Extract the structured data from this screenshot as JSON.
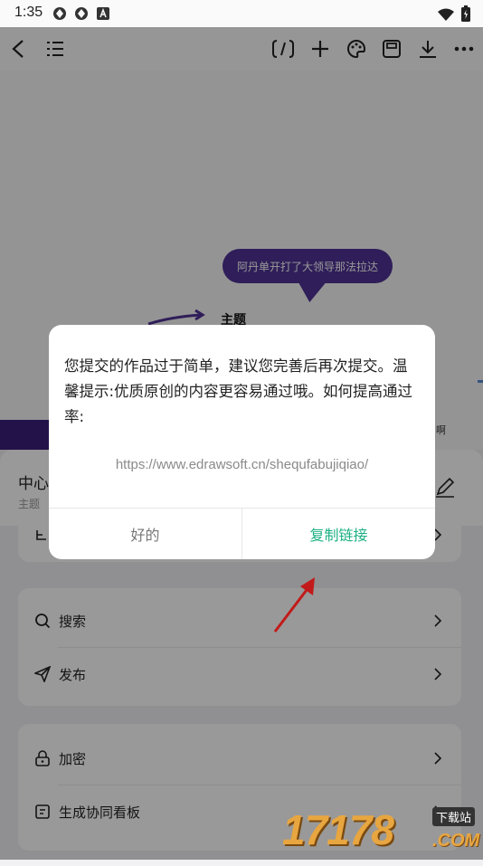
{
  "status_bar": {
    "time": "1:35"
  },
  "toolbar": {
    "back_icon": "back-arrow-icon",
    "outline_icon": "outline-list-icon",
    "format_icon": "format-bracket-icon",
    "add_icon": "plus-icon",
    "theme_icon": "palette-icon",
    "save_icon": "save-icon",
    "download_icon": "download-icon",
    "more_icon": "more-dots-icon"
  },
  "canvas": {
    "bubble_text": "阿丹单开打了大领导那法拉达",
    "topic_text": "主题",
    "edge_text": "啊"
  },
  "sheet": {
    "title": "中心",
    "subtitle": "主题",
    "items": [
      {
        "label": "搜索",
        "icon": "search-icon"
      },
      {
        "label": "发布",
        "icon": "send-icon"
      },
      {
        "label": "加密",
        "icon": "lock-icon"
      },
      {
        "label": "生成协同看板",
        "icon": "board-icon"
      }
    ]
  },
  "dialog": {
    "message": "您提交的作品过于简单，建议您完善后再次提交。温馨提示:优质原创的内容更容易通过哦。如何提高通过率:",
    "url": "https://www.edrawsoft.cn/shequfabujiqiao/",
    "ok_label": "好的",
    "copy_label": "复制链接",
    "accent_color": "#1db084"
  },
  "watermark": {
    "number": "17178",
    "tag": "下载站",
    "suffix": ".COM"
  }
}
